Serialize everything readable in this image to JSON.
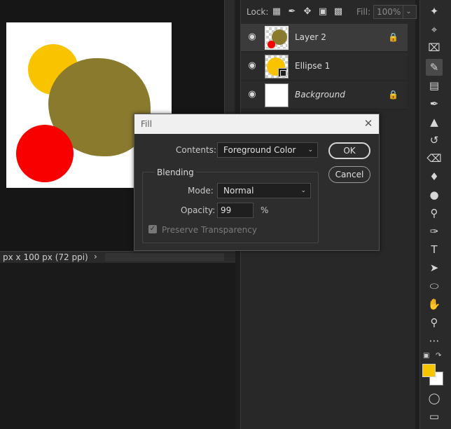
{
  "document": {
    "status_text": "px x 100 px (72 ppi)",
    "status_arrow": "›"
  },
  "layers_panel": {
    "lock_label": "Lock:",
    "fill_label": "Fill:",
    "fill_value": "100%",
    "layers": [
      {
        "name": "Layer 2",
        "selected": true,
        "locked": true
      },
      {
        "name": "Ellipse 1",
        "selected": false,
        "locked": false
      },
      {
        "name": "Background",
        "selected": false,
        "locked": true
      }
    ]
  },
  "fill_dialog": {
    "title": "Fill",
    "contents_label": "Contents:",
    "contents_value": "Foreground Color",
    "blending_title": "Blending",
    "mode_label": "Mode:",
    "mode_value": "Normal",
    "opacity_label": "Opacity:",
    "opacity_value": "99",
    "opacity_unit": "%",
    "preserve_transparency_label": "Preserve Transparency",
    "preserve_transparency_checked": true,
    "ok_label": "OK",
    "cancel_label": "Cancel"
  },
  "colors": {
    "foreground": "#f7c400",
    "background": "#ffffff",
    "yellow_circle": "#f9c300",
    "olive_circle": "#8a7a2e",
    "red_circle": "#f80000"
  },
  "toolbar": {
    "tools": [
      "magic-wand-icon",
      "crop-icon",
      "frame-icon",
      "eyedropper-icon",
      "healing-brush-icon",
      "brush-icon",
      "stamp-icon",
      "history-brush-icon",
      "eraser-icon",
      "paint-bucket-icon",
      "blur-icon",
      "dodge-icon",
      "pen-icon",
      "type-icon",
      "path-selection-icon",
      "ellipse-icon",
      "hand-icon",
      "zoom-icon",
      "more-icon"
    ],
    "active_tool": "eyedropper-icon"
  }
}
